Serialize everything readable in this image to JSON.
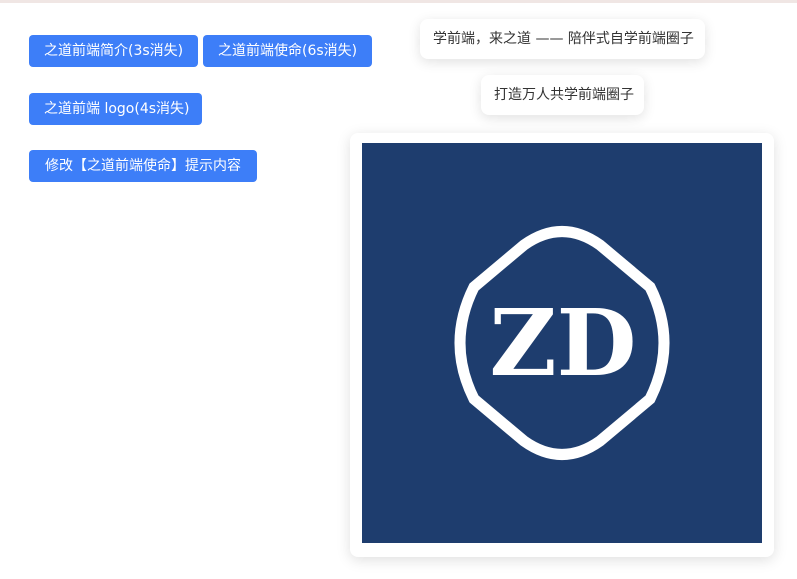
{
  "buttons": {
    "intro": "之道前端简介(3s消失)",
    "mission": "之道前端使命(6s消失)",
    "logo": "之道前端 logo(4s消失)",
    "modify_mission": "修改【之道前端使命】提示内容"
  },
  "toasts": {
    "intro": "学前端，来之道 —— 陪伴式自学前端圈子",
    "mission": "打造万人共学前端圈子"
  },
  "logo": {
    "text": "ZD",
    "background_color": "#1e3d6e",
    "foreground_color": "#ffffff"
  },
  "colors": {
    "button": "#3d7ef8",
    "toast_text": "#333333"
  }
}
